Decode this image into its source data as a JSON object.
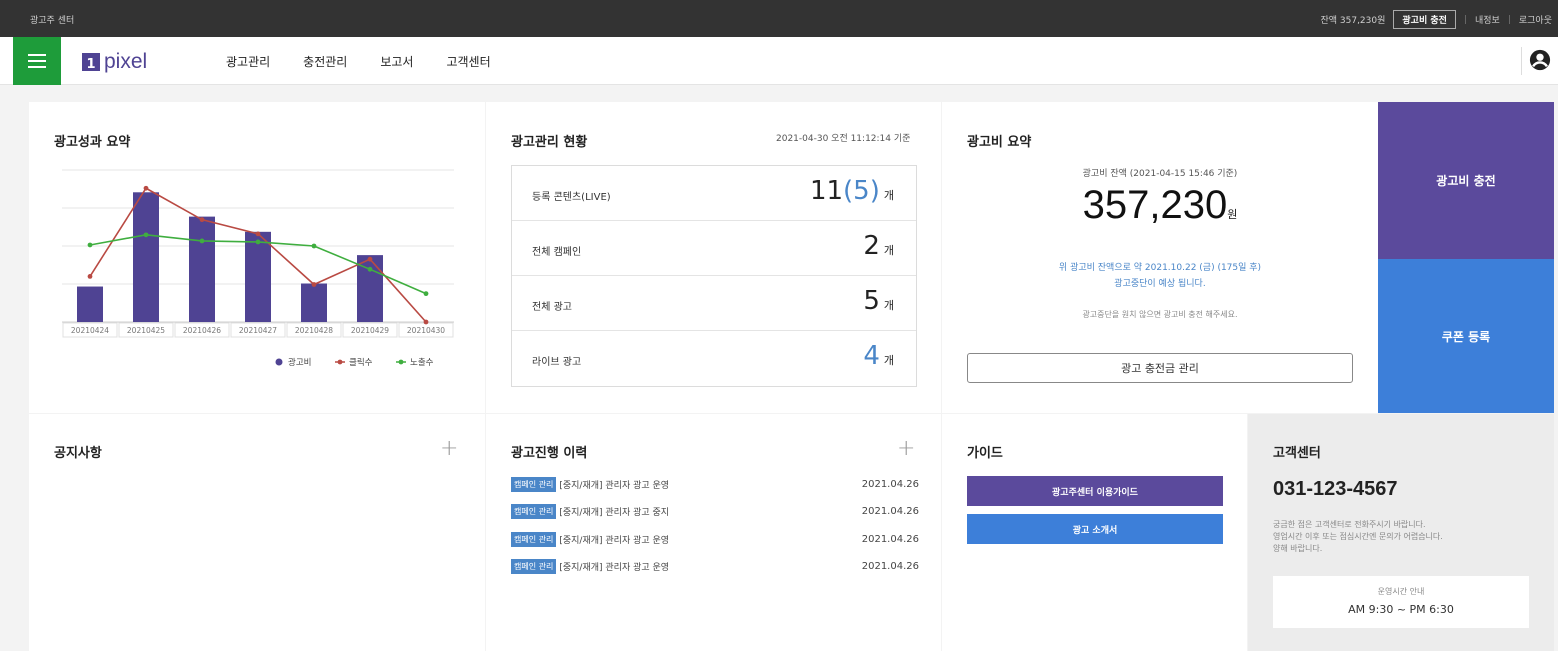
{
  "topbar": {
    "title": "광고주 센터",
    "balance": "잔액 357,230원",
    "charge_label": "광고비 충전",
    "myinfo": "내정보",
    "logout": "로그아웃"
  },
  "nav": {
    "logo_mark": "1",
    "logo_text": "pixel",
    "menu": [
      "광고관리",
      "충전관리",
      "보고서",
      "고객센터"
    ]
  },
  "performance": {
    "title": "광고성과 요약"
  },
  "chart_data": {
    "type": "bar",
    "categories": [
      "20210424",
      "20210425",
      "20210426",
      "20210427",
      "20210428",
      "20210429",
      "20210430"
    ],
    "series": [
      {
        "name": "광고비",
        "type": "bar",
        "color": "#4f4393",
        "values": [
          35,
          128,
          104,
          89,
          38,
          66,
          0
        ]
      },
      {
        "name": "클릭수",
        "type": "line",
        "color": "#b94a43",
        "values": [
          45,
          132,
          101,
          87,
          37,
          62,
          0
        ]
      },
      {
        "name": "노출수",
        "type": "line",
        "color": "#3fae3f",
        "values": [
          76,
          86,
          80,
          79,
          75,
          52,
          28
        ]
      }
    ],
    "ylim": [
      0,
      150
    ],
    "grid": true,
    "legend": "bottom-right"
  },
  "status": {
    "title": "광고관리 현황",
    "timestamp": "2021-04-30 오전 11:12:14 기준",
    "rows": [
      {
        "label": "등록 콘텐츠(LIVE)",
        "value": "11",
        "sub": "(5)",
        "unit": "개"
      },
      {
        "label": "전체 캠페인",
        "value": "2",
        "unit": "개"
      },
      {
        "label": "전체 광고",
        "value": "5",
        "unit": "개"
      },
      {
        "label": "라이브 광고",
        "value": "4",
        "unit": "개"
      }
    ]
  },
  "budget": {
    "title": "광고비 요약",
    "balance_caption": "광고비 잔액 (2021-04-15 15:46 기준)",
    "amount": "357,230",
    "amount_unit": "원",
    "forecast1": "위 광고비 잔액으로 약 2021.10.22 (금) (175일 후)",
    "forecast2": "광고중단이 예상 됩니다.",
    "hint": "광고중단을 원치 않으면 광고비 충전 해주세요.",
    "manage_label": "광고 충전금 관리",
    "charge_label": "광고비 충전",
    "coupon_label": "쿠폰 등록",
    "charge_color": "#5b4a9c",
    "coupon_color": "#3d7fd9"
  },
  "notice": {
    "title": "공지사항",
    "plus": "+"
  },
  "history": {
    "title": "광고진행 이력",
    "plus": "+",
    "rows": [
      {
        "tag": "캠페인 관리",
        "text": "[중지/재개] 관리자 광고 운영",
        "date": "2021.04.26"
      },
      {
        "tag": "캠페인 관리",
        "text": "[중지/재개] 관리자 광고 중지",
        "date": "2021.04.26"
      },
      {
        "tag": "캠페인 관리",
        "text": "[중지/재개] 관리자 광고 운영",
        "date": "2021.04.26"
      },
      {
        "tag": "캠페인 관리",
        "text": "[중지/재개] 관리자 광고 운영",
        "date": "2021.04.26"
      }
    ]
  },
  "guide": {
    "title": "가이드",
    "btn1": "광고주센터 이용가이드",
    "btn2": "광고 소개서"
  },
  "support": {
    "title": "고객센터",
    "phone": "031-123-4567",
    "desc1": "궁금한 점은 고객센터로 전화주시기 바랍니다.",
    "desc2": "영업시간 이후 또는 점심시간엔 문의가 어렵습니다.",
    "desc3": "양해 바랍니다.",
    "hours_caption": "운영시간 안내",
    "hours": "AM 9:30 ~ PM 6:30"
  }
}
